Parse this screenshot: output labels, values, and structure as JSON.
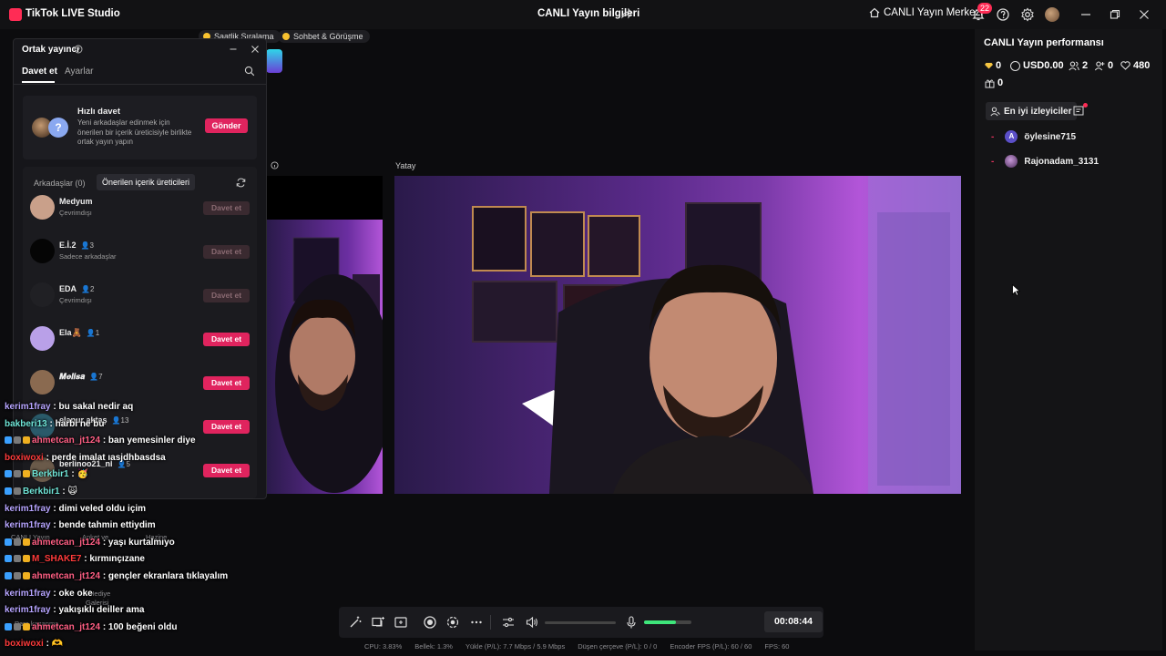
{
  "titlebar": {
    "app_name": "TikTok LIVE Studio",
    "stream_info": "CANLI Yayın bilgileri",
    "live_center": "CANLI Yayın Merkezi",
    "notification_count": "22"
  },
  "tags": [
    {
      "label": "Saatlik Sıralama"
    },
    {
      "label": "Sohbet & Görüşme"
    }
  ],
  "preview": {
    "landscape_label": "Yatay"
  },
  "performance": {
    "title": "CANLI Yayın performansı",
    "stats": {
      "diamonds": "0",
      "usd": "USD0.00",
      "viewers": "2",
      "followers": "0",
      "likes": "480",
      "gifts": "0"
    },
    "top_viewers_label": "En iyi izleyiciler",
    "viewers": [
      {
        "initial": "A",
        "name": "öylesine715",
        "color": "#5b4fc8"
      },
      {
        "initial": "",
        "name": "Rajonadam_3131",
        "color": "#7a4a8a"
      }
    ]
  },
  "cohost": {
    "title": "Ortak yayıncı",
    "tabs": {
      "invite": "Davet et",
      "settings": "Ayarlar"
    },
    "quick_invite": {
      "title": "Hızlı davet",
      "description": "Yeni arkadaşlar edinmek için önerilen bir içerik üreticisiyle birlikte ortak yayın yapın",
      "button": "Gönder"
    },
    "list_tabs": {
      "friends": "Arkadaşlar (0)",
      "suggested": "Önerilen içerik üreticileri"
    },
    "creators": [
      {
        "name": "Medyum",
        "status": "Çevrimdışı",
        "count": "",
        "button": "Davet et",
        "enabled": false,
        "avatar": "#c9a08a"
      },
      {
        "name": "E.İ.2",
        "status": "Sadece arkadaşlar",
        "count": "3",
        "button": "Davet et",
        "enabled": false,
        "avatar": "#050505"
      },
      {
        "name": "EDA",
        "status": "Çevrimdışı",
        "count": "2",
        "button": "Davet et",
        "enabled": false,
        "avatar": "#202024"
      },
      {
        "name": "Ela🧸",
        "status": "",
        "count": "1",
        "button": "Davet et",
        "enabled": true,
        "avatar": "#b9a0e8"
      },
      {
        "name": "𝑴𝒆𝒍𝒊𝒔𝒂",
        "status": "",
        "count": "7",
        "button": "Davet et",
        "enabled": true,
        "avatar": "#8a6a50"
      },
      {
        "name": "elanur aktaş",
        "status": "",
        "count": "13",
        "button": "Davet et",
        "enabled": true,
        "avatar": "#2a5a6a"
      },
      {
        "name": "berlinoo21_nl",
        "status": "",
        "count": "5",
        "button": "Davet et",
        "enabled": true,
        "avatar": "#6a5a4a"
      }
    ]
  },
  "chat": [
    {
      "user": "kerim1fray",
      "text": " : bu sakal nedir aq",
      "style": "u",
      "badges": 0
    },
    {
      "user": "bakberi13",
      "text": " : harbi ne bu",
      "style": "u3",
      "badges": 0
    },
    {
      "user": "ahmetcan_jt124",
      "text": " : ban yemesinler diye",
      "style": "u2",
      "badges": 3
    },
    {
      "user": "boxiwoxi",
      "text": " : perde imalat ıasjdhbasdsa",
      "style": "u4",
      "badges": 0
    },
    {
      "user": "Berkbir1",
      "text": " : 🥳",
      "style": "u3",
      "badges": 3
    },
    {
      "user": "Berkbir1",
      "text": " : 🙀",
      "style": "u3",
      "badges": 2
    },
    {
      "user": "kerim1fray",
      "text": " : dimi veled oldu içim",
      "style": "u",
      "badges": 0
    },
    {
      "user": "kerim1fray",
      "text": " : bende tahmin ettiydim",
      "style": "u",
      "badges": 0
    },
    {
      "user": "ahmetcan_jt124",
      "text": " : yaşı kurtalmıyo",
      "style": "u2",
      "badges": 3
    },
    {
      "user": "M_SHAKE7",
      "text": " : kırmınçızane",
      "style": "u4",
      "badges": 3
    },
    {
      "user": "ahmetcan_jt124",
      "text": " : gençler ekranlara tıklayalım",
      "style": "u2",
      "badges": 3
    },
    {
      "user": "kerim1fray",
      "text": " : oke oke",
      "style": "u",
      "badges": 0
    },
    {
      "user": "kerim1fray",
      "text": " : yakışıklı deiller ama",
      "style": "u",
      "badges": 0
    },
    {
      "user": "ahmetcan_jt124",
      "text": " : 100 beğeni oldu",
      "style": "u2",
      "badges": 3
    },
    {
      "user": "boxiwoxi",
      "text": " : 🫶",
      "style": "u4",
      "badges": 0
    }
  ],
  "left_tools": {
    "live_label": "CANLI Yayın",
    "poll_label": "Anket ve",
    "treasure_label": "Hazine",
    "gift_label": "Hediye",
    "gallery_label": "Galerisi",
    "earn_label": "Para kazanma"
  },
  "toolbar": {
    "timer": "00:08:44",
    "mic_level": 0.68
  },
  "status": {
    "cpu": "CPU:  3.83%",
    "memory": "Bellek:  1.3%",
    "upload": "Yükle (P/L):  7.7 Mbps / 5.9 Mbps",
    "dropped": "Düşen çerçeve (P/L):  0 / 0",
    "encoder": "Encoder FPS (P/L):  60 / 60",
    "fps": "FPS:  60"
  },
  "colors": {
    "accent": "#e0245e",
    "panel": "#16161a",
    "background": "#0c0c0e",
    "mic_green": "#3ee57a"
  }
}
